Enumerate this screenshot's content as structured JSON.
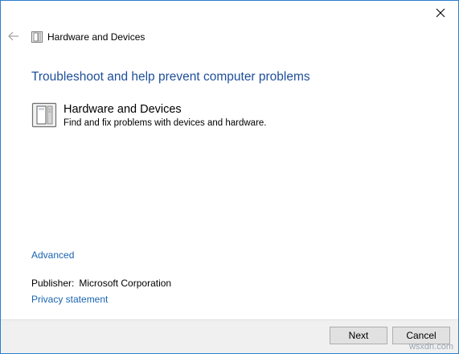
{
  "window": {
    "header_title": "Hardware and Devices"
  },
  "main": {
    "heading": "Troubleshoot and help prevent computer problems",
    "item": {
      "title": "Hardware and Devices",
      "description": "Find and fix problems with devices and hardware."
    },
    "advanced_link": "Advanced",
    "publisher": {
      "label": "Publisher:",
      "value": "Microsoft Corporation"
    },
    "privacy_link": "Privacy statement"
  },
  "footer": {
    "next_label": "Next",
    "cancel_label": "Cancel",
    "watermark": "wsxdn.com"
  },
  "icons": {
    "back": "back-arrow-icon",
    "close": "close-icon",
    "header": "hardware-devices-icon",
    "item": "hardware-devices-icon"
  },
  "colors": {
    "heading": "#1e4f9a",
    "link": "#1a64b0",
    "border": "#2b7fd0",
    "footer_bg": "#f0f0f0"
  }
}
